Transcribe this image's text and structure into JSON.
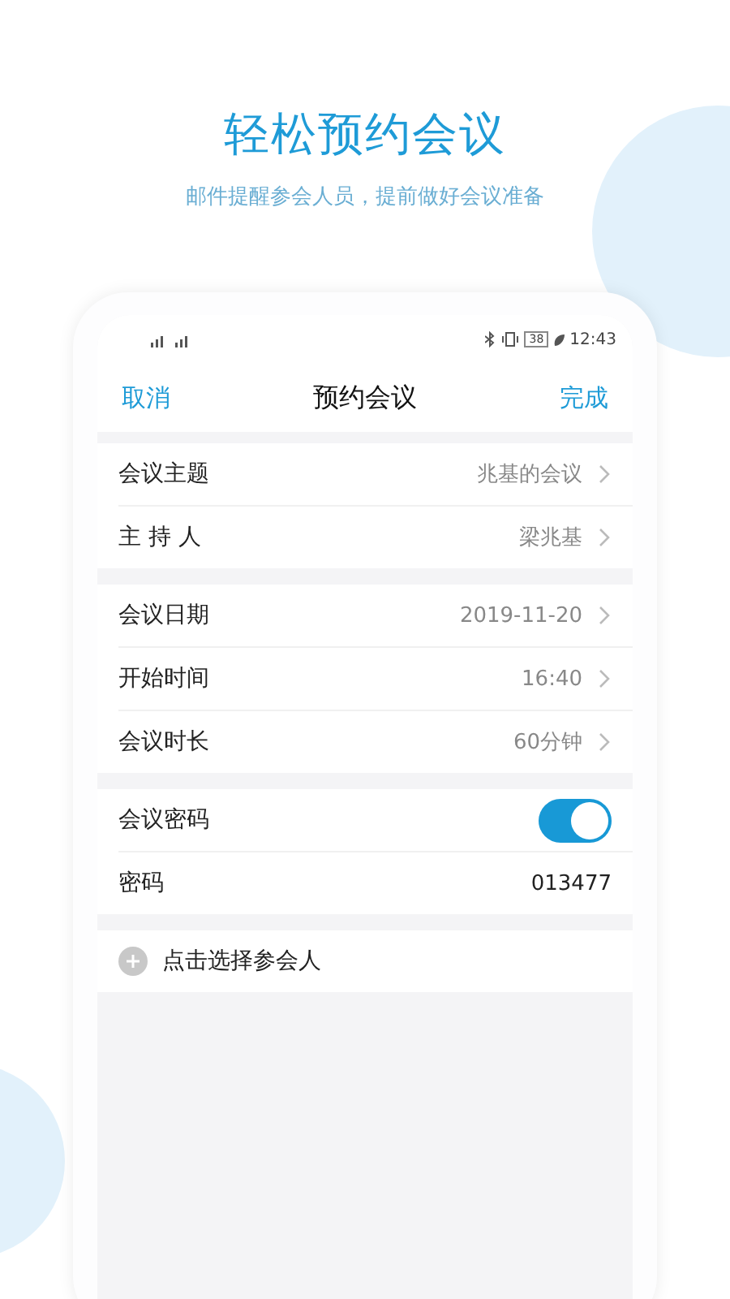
{
  "hero": {
    "title": "轻松预约会议",
    "subtitle": "邮件提醒参会人员，提前做好会议准备"
  },
  "status_bar": {
    "battery": "38",
    "time": "12:43"
  },
  "nav": {
    "left": "取消",
    "title": "预约会议",
    "right": "完成"
  },
  "groups": [
    {
      "rows": [
        {
          "kind": "link",
          "label": "会议主题",
          "value": "兆基的会议"
        },
        {
          "kind": "link",
          "label": "主 持 人",
          "value": "梁兆基"
        }
      ]
    },
    {
      "rows": [
        {
          "kind": "link",
          "label": "会议日期",
          "value": "2019-11-20"
        },
        {
          "kind": "link",
          "label": "开始时间",
          "value": "16:40"
        },
        {
          "kind": "link",
          "label": "会议时长",
          "value": "60分钟"
        }
      ]
    },
    {
      "rows": [
        {
          "kind": "toggle",
          "label": "会议密码",
          "on": true
        },
        {
          "kind": "value",
          "label": "密码",
          "value": "013477"
        }
      ]
    },
    {
      "rows": [
        {
          "kind": "add",
          "label": "点击选择参会人"
        }
      ]
    }
  ]
}
